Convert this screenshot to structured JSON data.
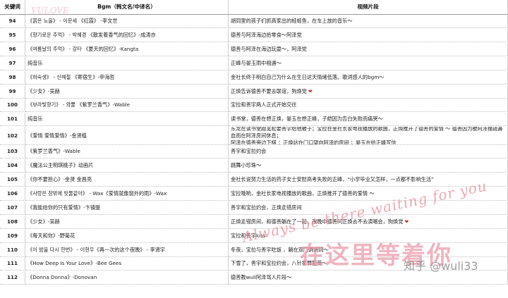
{
  "header": {
    "keyword": "关键词",
    "bgm": "Bgm（韩文名/中译名）",
    "scene": "视频片段"
  },
  "rows": [
    {
      "key": "94",
      "bgm": "《붉은 노을》 - 이문세 《红霞》 -李文世",
      "scene": [
        "胡同里的孩子们抓高家出的蛙蛙鱼，在车上放的音乐～"
      ]
    },
    {
      "key": "95",
      "bgm": "《향기로운 추억》 - 박혜경 《散发着香气的回忆》-成涛亦",
      "scene": [
        "德善与阿泽海边拾零食～阿泽党"
      ]
    },
    {
      "key": "96",
      "bgm": "《여름날의 추억》 - 강타 《夏天的回忆》-Kangta",
      "scene": [
        "德善与阿泽在海边玩耍～，阿泽党"
      ]
    },
    {
      "key": "97",
      "bgm": "纯音乐",
      "scene": [
        "正峰与晏玉雨中相遇～"
      ]
    },
    {
      "key": "98",
      "bgm": "《하숙생》 - 신해철 《寄宿生》-申海哲",
      "scene": [
        "金社长终于明白自己为什么在生日这天情绪低落。歌词感人的bgm～"
      ]
    },
    {
      "key": "99",
      "bgm": "《少女》-吴赫",
      "scene": [
        "正焕告诉德善不要去联谊，狗焕党",
        "❤"
      ]
    },
    {
      "key": "100",
      "bgm": "《보라빛향기》 - 와쭐 《紫罗兰香气》-Wable",
      "scene": [
        "宝拉和善宇两人正式开始交往"
      ]
    },
    {
      "key": "101",
      "bgm": "纯音乐",
      "scene": [
        "读书堂，德善在想正焕，晏玉在想正峰，子皑因为告白失败而痛哭～"
      ]
    },
    {
      "key": "102",
      "bgm": "《爱情 爱情爱情》-金贤植",
      "scene": [
        "东龙在读书堂蹭宽松要善宇给他被子；宝拉在金社长家电视播放的歌曲，正焕推开了德善的爱情  ～ 德善因为被阿泽撞疏鼻血而在阿泽房间休息；",
        "阿泽在德善旁边下棋  ：正焕站在门口望向阿泽的房间  ；晏玉在给正峰写信"
      ],
      "tall": true
    },
    {
      "key": "103",
      "bgm": "《紫罗兰香气》-Wable",
      "scene": [
        "善宇和宝拉约会"
      ]
    },
    {
      "key": "104",
      "bgm": "《魔法公主明琪桃子》动画片",
      "scene": [
        "跳舞小珍珠～"
      ]
    },
    {
      "key": "105",
      "bgm": "《你不要担心》-金贤 金昌亮",
      "scene": [
        "金社长说努力生活的药子女士安慰高考失败的正峰，“小学毕业又怎样，一点都不影响生活”"
      ]
    },
    {
      "key": "106",
      "bgm": "《사랑은 창밖에 빗물같아》 - Wax《爱情就像窗外的雨》-Wax",
      "scene": [
        "宝拉哦哟，金社长家电视播放的歌曲，正焕推开了德善的爱情  ～"
      ]
    },
    {
      "key": "107",
      "bgm": "《我能给你的只有爱情》-卞镇燮",
      "scene": [
        "善宇和宝拉约会，正焕走错房间"
      ]
    },
    {
      "key": "108",
      "bgm": "《少女》-吴赫",
      "scene": [
        "正焕走错房间，和德善躺在了一起，夜晚中德善问正焕去不去演唱会，狗焕党",
        "❤"
      ]
    },
    {
      "key": "109",
      "bgm": "《每天和你》-野菊花",
      "scene": [
        "宝拉和善宇kiss"
      ]
    },
    {
      "key": "110",
      "bgm": "《이 밤을 다시 한번》 - 이현우《再一次的这个夜晚》 - 李贤宇",
      "scene": [
        "冬夜，宝拉与善宇吃饭    ，躺在双门洞胡同～"
      ]
    },
    {
      "key": "111",
      "bgm": "《How Deep Is Your Love》-Bee Gees",
      "scene": [
        "下雪了，善宇和宝拉约会，八针家罪犯受～"
      ]
    },
    {
      "key": "112",
      "bgm": "《Donna Donna》-Donovan",
      "scene": [
        "德善教wuli阿泽骂人片段～"
      ]
    }
  ],
  "watermarks": {
    "cursive": "Always be there waiting for you",
    "chinese": "在这里等着你",
    "zhihu": "知乎 @wuli33",
    "top_left": "VULOVE"
  }
}
